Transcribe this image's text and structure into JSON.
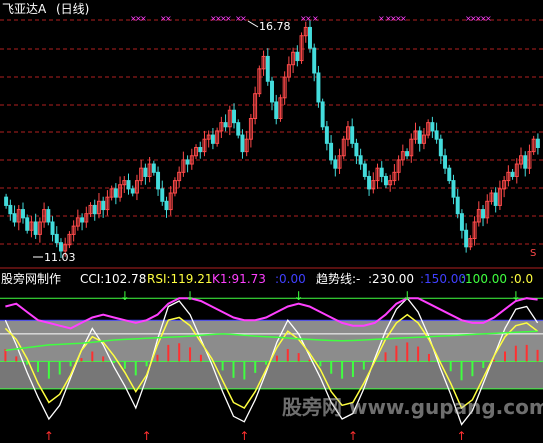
{
  "price_panel": {
    "title": "飞亚达A",
    "period": "(日线)",
    "high_label": "16.78",
    "low_label": "11.03"
  },
  "indicator_panel": {
    "source": "股旁网制作",
    "cci": "CCI:102.78",
    "rsi": "RSI:119.21",
    "k1": "K1:91.73",
    "v0": ":0.00",
    "trend": "趋势线:-",
    "v230": ":230.00",
    "v150": ":150.00",
    "v100": ":100.00",
    "v0b": ":0.0"
  },
  "watermark": "股旁网 www.gupang.com",
  "colors": {
    "background": "#000000",
    "up_candle": "#ff4a4a",
    "down_candle": "#44dcdc",
    "grid": "#b02020",
    "marker": "#ff40ff",
    "cci_line": "#ffffff",
    "rsi_line": "#ffff40",
    "k1_line": "#ff40ff",
    "trend_line": "#40ff40",
    "accent_blue": "#4040ff",
    "signal_green": "#40ff40",
    "signal_red": "#ff3030",
    "band_gray": "#8c8c8c"
  },
  "chart_data": [
    {
      "type": "candlestick",
      "title": "飞亚达A (日线)",
      "ylim": [
        11.03,
        16.78
      ],
      "annotations": [
        "16.78",
        "11.03"
      ],
      "close": [
        12.3,
        12.1,
        11.9,
        12.2,
        12.0,
        11.7,
        11.9,
        11.6,
        11.9,
        12.2,
        11.9,
        11.6,
        11.4,
        11.2,
        11.35,
        11.6,
        11.8,
        12.0,
        11.9,
        12.1,
        12.3,
        12.1,
        12.4,
        12.2,
        12.5,
        12.7,
        12.5,
        12.8,
        12.9,
        12.7,
        12.6,
        12.9,
        13.2,
        13.0,
        13.3,
        13.1,
        12.7,
        12.4,
        12.2,
        12.6,
        12.9,
        13.1,
        13.4,
        13.3,
        13.5,
        13.7,
        13.6,
        13.9,
        14.0,
        13.8,
        14.1,
        14.3,
        14.2,
        14.6,
        14.3,
        14.0,
        13.6,
        13.9,
        14.4,
        15.0,
        15.6,
        15.9,
        15.3,
        14.8,
        14.4,
        14.9,
        15.4,
        15.7,
        16.0,
        15.8,
        16.4,
        16.6,
        16.1,
        15.5,
        14.8,
        14.2,
        13.8,
        13.4,
        13.2,
        13.5,
        13.9,
        14.2,
        13.8,
        13.5,
        13.3,
        13.0,
        12.7,
        12.9,
        13.2,
        13.0,
        12.8,
        12.9,
        13.1,
        13.4,
        13.6,
        13.5,
        13.9,
        14.1,
        13.8,
        14.0,
        14.3,
        14.1,
        13.9,
        13.5,
        13.2,
        12.9,
        12.5,
        12.1,
        11.7,
        11.3,
        11.5,
        11.9,
        12.2,
        12.0,
        12.4,
        12.6,
        12.3,
        12.7,
        12.9,
        13.1,
        13.0,
        13.3,
        13.5,
        13.2,
        13.6,
        13.9,
        13.7
      ],
      "open": [
        12.5,
        12.3,
        12.1,
        11.9,
        12.2,
        12.0,
        11.7,
        11.9,
        11.6,
        11.9,
        12.2,
        11.9,
        11.6,
        11.4,
        11.2,
        11.35,
        11.6,
        11.8,
        12.0,
        11.9,
        12.1,
        12.3,
        12.1,
        12.4,
        12.2,
        12.5,
        12.7,
        12.5,
        12.8,
        12.9,
        12.7,
        12.6,
        12.9,
        13.2,
        13.0,
        13.3,
        13.1,
        12.7,
        12.4,
        12.2,
        12.6,
        12.9,
        13.1,
        13.4,
        13.3,
        13.5,
        13.7,
        13.6,
        13.9,
        14.0,
        13.8,
        14.1,
        14.3,
        14.2,
        14.6,
        14.3,
        14.0,
        13.6,
        13.9,
        14.4,
        15.0,
        15.6,
        15.9,
        15.3,
        14.8,
        14.4,
        14.9,
        15.4,
        15.7,
        16.0,
        15.8,
        16.4,
        16.6,
        16.1,
        15.5,
        14.8,
        14.2,
        13.8,
        13.4,
        13.2,
        13.5,
        13.9,
        14.2,
        13.8,
        13.5,
        13.3,
        13.0,
        12.7,
        12.9,
        13.2,
        13.0,
        12.8,
        12.9,
        13.1,
        13.4,
        13.6,
        13.5,
        13.9,
        14.1,
        13.8,
        14.0,
        14.3,
        14.1,
        13.9,
        13.5,
        13.2,
        12.9,
        12.5,
        12.1,
        11.7,
        11.3,
        11.5,
        11.9,
        12.2,
        12.0,
        12.4,
        12.6,
        12.3,
        12.7,
        12.9,
        13.1,
        13.0,
        13.3,
        13.5,
        13.2,
        13.6,
        13.9
      ]
    },
    {
      "type": "line",
      "series": [
        {
          "name": "CCI",
          "values": [
            150,
            60,
            -40,
            -130,
            -210,
            -160,
            -60,
            40,
            120,
            60,
            -20,
            -90,
            -170,
            -60,
            80,
            200,
            220,
            170,
            80,
            -10,
            -110,
            -200,
            -220,
            -140,
            -40,
            70,
            150,
            100,
            20,
            -60,
            -150,
            -210,
            -190,
            -100,
            10,
            110,
            190,
            230,
            180,
            90,
            -20,
            -120,
            -230,
            -180,
            -80,
            20,
            120,
            190,
            200,
            140
          ]
        },
        {
          "name": "RSI",
          "values": [
            120,
            80,
            10,
            -80,
            -150,
            -120,
            -50,
            40,
            90,
            70,
            20,
            -40,
            -110,
            -50,
            60,
            150,
            160,
            130,
            70,
            10,
            -70,
            -150,
            -170,
            -110,
            -30,
            50,
            110,
            80,
            30,
            -30,
            -110,
            -160,
            -150,
            -80,
            0,
            80,
            140,
            170,
            140,
            80,
            0,
            -80,
            -170,
            -140,
            -60,
            20,
            90,
            130,
            140,
            110
          ]
        },
        {
          "name": "K1",
          "values": [
            200,
            210,
            180,
            150,
            140,
            130,
            120,
            140,
            160,
            170,
            160,
            150,
            140,
            150,
            170,
            210,
            230,
            230,
            220,
            200,
            180,
            160,
            150,
            150,
            160,
            180,
            200,
            210,
            200,
            180,
            160,
            140,
            130,
            130,
            140,
            170,
            210,
            230,
            230,
            210,
            190,
            170,
            150,
            140,
            140,
            160,
            190,
            220,
            230,
            225
          ]
        },
        {
          "name": "趋势线",
          "values": [
            40,
            45,
            50,
            55,
            60,
            62,
            64,
            66,
            70,
            74,
            78,
            80,
            82,
            84,
            86,
            88,
            90,
            92,
            95,
            98,
            100,
            98,
            95,
            92,
            90,
            88,
            85,
            82,
            80,
            78,
            76,
            75,
            76,
            78,
            80,
            82,
            84,
            86,
            88,
            90,
            92,
            94,
            96,
            98,
            100,
            102,
            104,
            106,
            108,
            110
          ]
        }
      ],
      "reference_lines": [
        230,
        150,
        100,
        0
      ],
      "ylim": [
        -250,
        260
      ]
    }
  ]
}
